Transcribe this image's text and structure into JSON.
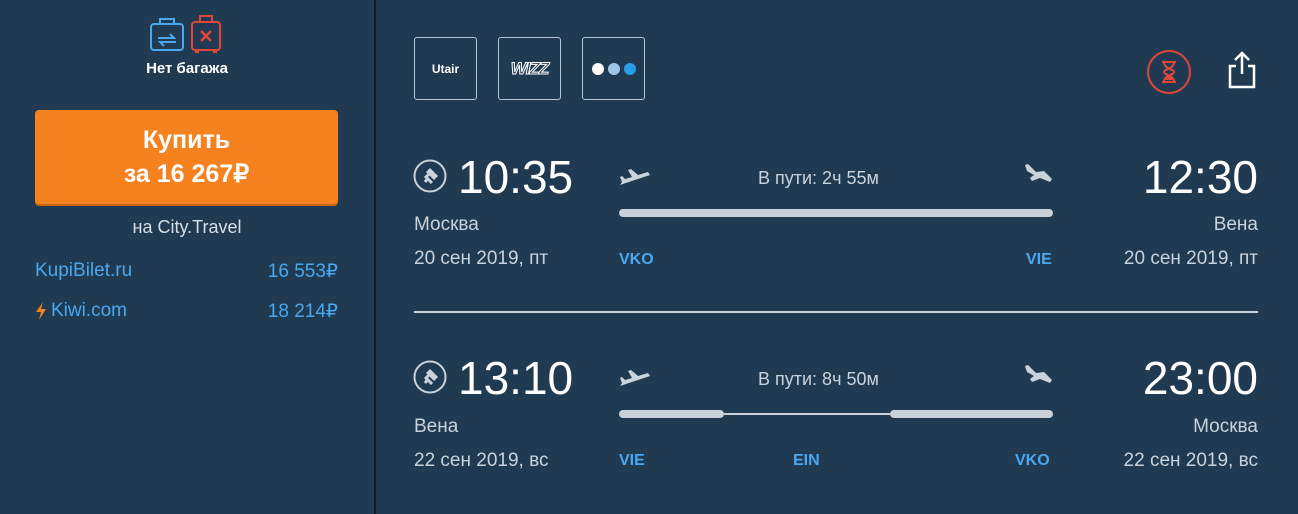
{
  "baggage": {
    "label": "Нет багажа"
  },
  "buy": {
    "line1": "Купить",
    "line2": "за 16 267₽",
    "seller": "на City.Travel"
  },
  "offers": [
    {
      "name": "KupiBilet.ru",
      "price": "16 553₽"
    },
    {
      "name": "Kiwi.com",
      "price": "18 214₽"
    }
  ],
  "airlines": [
    {
      "name": "Utair",
      "icon": "utair-logo"
    },
    {
      "name": "WIZZ",
      "icon": "wizz-logo"
    },
    {
      "name": "",
      "icon": "dots-logo"
    }
  ],
  "segments": [
    {
      "dep_time": "10:35",
      "dep_city": "Москва",
      "dep_date": "20 сен 2019, пт",
      "dep_iata": "VKO",
      "arr_time": "12:30",
      "arr_city": "Вена",
      "arr_date": "20 сен 2019, пт",
      "arr_iata": "VIE",
      "duration": "В пути: 2ч 55м"
    },
    {
      "dep_time": "13:10",
      "dep_city": "Вена",
      "dep_date": "22 сен 2019, вс",
      "dep_iata": "VIE",
      "arr_time": "23:00",
      "arr_city": "Москва",
      "arr_date": "22 сен 2019, вс",
      "arr_iata": "VKO",
      "duration": "В пути: 8ч 50м",
      "stop_iata": "EIN"
    }
  ],
  "colors": {
    "accent": "#f5821f",
    "link": "#4aa8f0",
    "bg": "#203a52",
    "timer": "#e2463a"
  }
}
